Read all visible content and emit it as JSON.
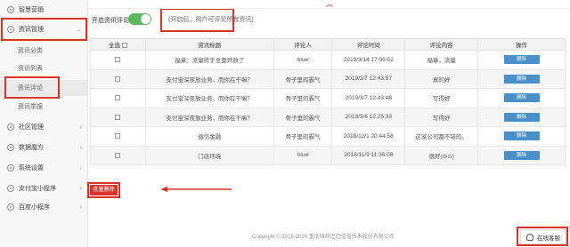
{
  "sidebar": {
    "top_item": {
      "label": "智慧营销"
    },
    "group": {
      "label": "资讯管理",
      "arrow": "⌄"
    },
    "sub_items": [
      {
        "label": "资讯分类"
      },
      {
        "label": "资讯列表"
      },
      {
        "label": "资讯评论"
      },
      {
        "label": "资讯举报"
      }
    ],
    "items": [
      {
        "label": "社区管理",
        "arrow": "›"
      },
      {
        "label": "数据魔方",
        "arrow": "›"
      },
      {
        "label": "系统设置",
        "arrow": "›"
      },
      {
        "label": "支付宝小程序",
        "arrow": "›"
      },
      {
        "label": "百度小程序",
        "arrow": "›"
      }
    ]
  },
  "toolbar": {
    "toggle_label": "开启资讯评论:",
    "toggle_on": true,
    "tip": "(开启后，用户可评论所有资讯)"
  },
  "table": {
    "headers": {
      "select_all": "全选",
      "title": "资讯标题",
      "commenter": "评论人",
      "time": "评论时间",
      "content": "评论内容",
      "action": "操作"
    },
    "rows": [
      {
        "title": "福章：流量终于全面开放了",
        "commenter": "blue",
        "time": "2019/3/14 17:56:52",
        "content": "福章，流量"
      },
      {
        "title": "支付宝深夜放业务，而你在干嘛？",
        "commenter": "骨子里的霸气",
        "time": "2019/3/7 12:43:57",
        "content": "真的好"
      },
      {
        "title": "支付宝深夜放业务，而你在干嘛？",
        "commenter": "骨子里的霸气",
        "time": "2019/3/7 12:43:48",
        "content": "写得好"
      },
      {
        "title": "支付宝深夜放业务，而你在干嘛？",
        "commenter": "骨子里的霸气",
        "time": "2019/3/6 12:25:33",
        "content": "写得好"
      },
      {
        "title": "微信金融",
        "commenter": "骨子里的霸气",
        "time": "2018/12/1 20:44:58",
        "content": "这家公司都不错的。"
      },
      {
        "title": "门店环境",
        "commenter": "blue",
        "time": "2018/11/9 11:36:08",
        "content": "很好(⊙⊙)"
      }
    ],
    "delete_label": "删除"
  },
  "batch_delete_label": "批量删除",
  "footer": {
    "copyright": "Copyright © 2016-2020 重庆微商巴巴信息技术股份有限公司"
  },
  "service": {
    "label": "在线客服"
  },
  "colors": {
    "accent_red": "#d9332b",
    "toggle_green": "#5cb85c",
    "button_blue": "#4a90c8"
  }
}
